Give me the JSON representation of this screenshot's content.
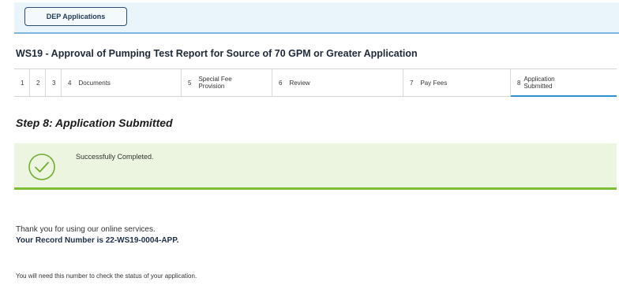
{
  "header": {
    "button_label": "DEP Applications"
  },
  "application": {
    "title": "WS19 - Approval of Pumping Test Report for Source of 70 GPM or Greater Application"
  },
  "steps": [
    {
      "number": "1",
      "label": ""
    },
    {
      "number": "2",
      "label": ""
    },
    {
      "number": "3",
      "label": ""
    },
    {
      "number": "4",
      "label": "Documents"
    },
    {
      "number": "5",
      "label": "Special Fee Provision"
    },
    {
      "number": "6",
      "label": "Review"
    },
    {
      "number": "7",
      "label": "Pay Fees"
    },
    {
      "number": "8",
      "label": "Application Submitted"
    }
  ],
  "main": {
    "step_heading": "Step 8: Application Submitted",
    "success_message": "Successfully Completed.",
    "thanks_text": "Thank you for using our online services.",
    "record_text": "Your Record Number is 22-WS19-0004-APP.",
    "status_note": "You will need this number to check the status of your application."
  },
  "colors": {
    "header_bg": "#eaf4fb",
    "success_bg": "#ebf5df",
    "success_accent": "#7cbf34",
    "active_step_underline": "#2f8fd0"
  }
}
